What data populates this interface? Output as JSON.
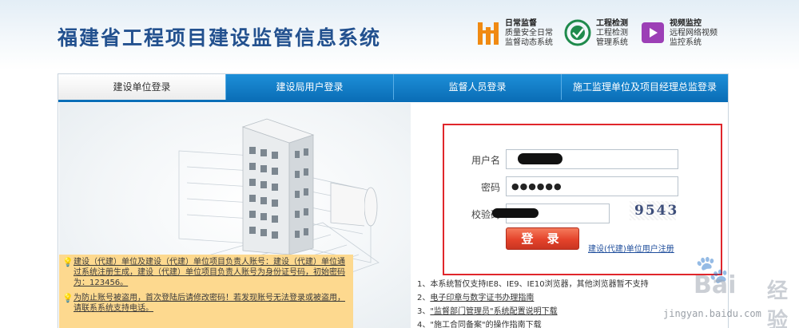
{
  "header": {
    "title": "福建省工程项目建设监管信息系统",
    "systems": [
      {
        "line1": "日常监督",
        "line2": "质量安全日常",
        "line3": "监督动态系统",
        "icon": "building-crane-icon"
      },
      {
        "line1": "工程检测",
        "line2": "工程检测",
        "line3": "管理系统",
        "icon": "inspection-circle-icon"
      },
      {
        "line1": "视频监控",
        "line2": "远程网络视频",
        "line3": "监控系统",
        "icon": "video-camera-icon"
      }
    ]
  },
  "tabs": [
    {
      "label": "建设单位登录",
      "active": true
    },
    {
      "label": "建设局用户登录",
      "active": false
    },
    {
      "label": "监督人员登录",
      "active": false
    },
    {
      "label": "施工监理单位及项目经理总监登录",
      "active": false
    }
  ],
  "notices": [
    "建设（代建）单位及建设（代建）单位项目负责人账号：建设（代建）单位通过系统注册生成，建设（代建）单位项目负责人账号为身份证号码，初始密码为：123456。",
    "为防止账号被盗用，首次登陆后请修改密码！若发现账号无法登录或被盗用，请联系系统支持电话。"
  ],
  "login": {
    "username_label": "用户名",
    "password_label": "密码",
    "password_mask": "●●●●●●",
    "captcha_label": "校验码",
    "captcha_value": "9543",
    "login_button": "登 录",
    "register_link": "建设(代建)单位用户注册"
  },
  "info_lines": [
    {
      "prefix": "1、",
      "text": "本系统暂仅支持IE8、IE9、IE10浏览器，其他浏览器暂不支持",
      "link": false
    },
    {
      "prefix": "2、",
      "text": "电子印章与数字证书办理指南",
      "link": true
    },
    {
      "prefix": "3、",
      "text": "\"监督部门管理员\"系统配置说明下载",
      "link": true
    },
    {
      "prefix": "4、",
      "text": "\"施工合同备案\"的操作指南下载",
      "link": true
    }
  ],
  "watermark": {
    "brand": "Bai",
    "brand_cn": "经验",
    "url": "jingyan.baidu.com"
  },
  "colors": {
    "title": "#23518f",
    "tab_blue": "#0b6fb8",
    "highlight_border": "#e0262b",
    "login_button": "#e4432b",
    "notice_bg": "#fdd98f"
  }
}
